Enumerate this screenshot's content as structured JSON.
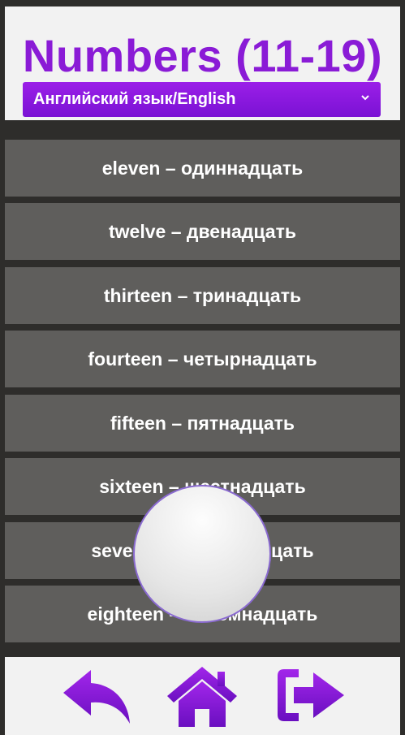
{
  "header": {
    "title": "Numbers (11-19)",
    "language_select": {
      "label": "Английский язык/English",
      "icon": "chevron-down-icon"
    }
  },
  "items": [
    {
      "text": "eleven – одиннадцать"
    },
    {
      "text": "twelve – двенадцать"
    },
    {
      "text": "thirteen – тринадцать"
    },
    {
      "text": "fourteen – четырнадцать"
    },
    {
      "text": "fifteen – пятнадцать"
    },
    {
      "text": "sixteen – шестнадцать"
    },
    {
      "text": "seventeen – семнадцать"
    },
    {
      "text": "eighteen – восемнадцать"
    }
  ],
  "footer": {
    "buttons": [
      {
        "icon": "back-arrow-icon"
      },
      {
        "icon": "home-icon"
      },
      {
        "icon": "exit-icon"
      }
    ]
  },
  "colors": {
    "accent": "#8a1bd6",
    "accent_dark": "#6a0fc0",
    "item_bg": "#5f5e5c",
    "page_bg": "#2e2d2b"
  }
}
